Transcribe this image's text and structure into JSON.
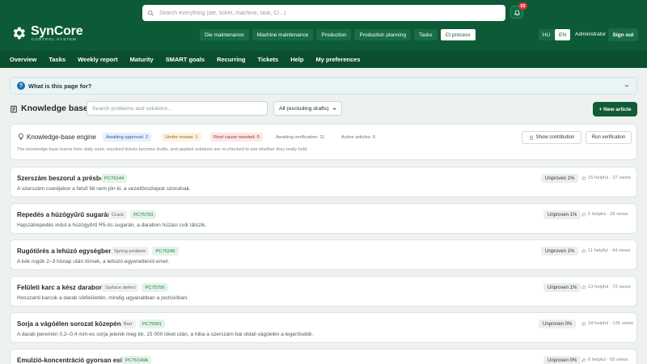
{
  "header": {
    "logo_main": "SynCore",
    "logo_sub": "CONTROL SYSTEM",
    "search_placeholder": "Search everything (die, ticket, machine, task, CI...)",
    "notification_count": "53",
    "main_nav": [
      {
        "label": "Die maintenance",
        "active": false
      },
      {
        "label": "Machine maintenance",
        "active": false
      },
      {
        "label": "Production",
        "active": false
      },
      {
        "label": "Production planning",
        "active": false
      },
      {
        "label": "Tasks",
        "active": false
      },
      {
        "label": "CI process",
        "active": true
      }
    ],
    "languages": [
      {
        "label": "HU",
        "active": false
      },
      {
        "label": "EN",
        "active": true
      }
    ],
    "user": "Administrator",
    "sign_out": "Sign out"
  },
  "subnav": [
    "Overview",
    "Tasks",
    "Weekly report",
    "Maturity",
    "SMART goals",
    "Recurring",
    "Tickets",
    "Help",
    "My preferences"
  ],
  "faq": {
    "text": "What is this page for?"
  },
  "knowledge_base": {
    "title": "Knowledge base",
    "search_placeholder": "Search problems and solutions...",
    "filter_value": "All (excluding drafts)",
    "new_article": "+ New article"
  },
  "engine": {
    "title": "Knowledge-base engine",
    "awaiting_approval": "Awaiting approval: 2",
    "under_review": "Under review: 1",
    "root_cause_needed": "Root cause needed: 0",
    "awaiting_verification": "Awaiting verification: 11",
    "active_articles": "Active articles: 6",
    "description": "The knowledge base learns from daily work: resolved tickets become drafts, and applied solutions are re-checked to see whether they really held.",
    "show_contribution": "Show contribution",
    "run_verification": "Run verification"
  },
  "articles": [
    {
      "title": "Szerszám beszorul a présbe",
      "category": "",
      "code": "PC76144",
      "summary": "A szerszám cseréjekor a felső fél nem jön ki, a vezetőoszlopok szorulnak.",
      "status": "Unproven 1%",
      "helpful": "15 helpful",
      "views": "37 views"
    },
    {
      "title": "Repedés a húzógyűrű sugarán",
      "category": "Crack",
      "code": "PC75753",
      "summary": "Hajszálrepedés indul a húzógyűrű R5-ös sugarán, a darabon húzási csík látszik.",
      "status": "Unproven 1%",
      "helpful": "5 helpful",
      "views": "28 views"
    },
    {
      "title": "Rugótörés a lehúzó egységben",
      "category": "Spring problem",
      "code": "PC76246",
      "summary": "A kék rugók 2–3 hónap után törnek, a lehúzó egyenetlenül emel.",
      "status": "Unproven 1%",
      "helpful": "11 helpful",
      "views": "44 views"
    },
    {
      "title": "Felületi karc a kész darabon",
      "category": "Surface defect",
      "code": "PC75756",
      "summary": "Hosszanti karcok a darab síkfelületén, mindig ugyanabban a pozícióban.",
      "status": "Unproven 1%",
      "helpful": "13 helpful",
      "views": "72 views"
    },
    {
      "title": "Sorja a vágóélen sorozat közepén",
      "category": "Burr",
      "code": "PC75001",
      "summary": "A darab peremén 0,2–0,4 mm-es sorja jelenik meg kb. 15 000 löket után, a hiba a szerszám bal oldali vágóélén a legerősebb.",
      "status": "Unproven 0%",
      "helpful": "18 helpful",
      "views": "136 views"
    },
    {
      "title": "Emulzió-koncentráció gyorsan esik",
      "category": "",
      "code": "PC76140A",
      "summary": "",
      "status": "Unproven 0%",
      "helpful": "6 helpful",
      "views": "65 views"
    }
  ]
}
